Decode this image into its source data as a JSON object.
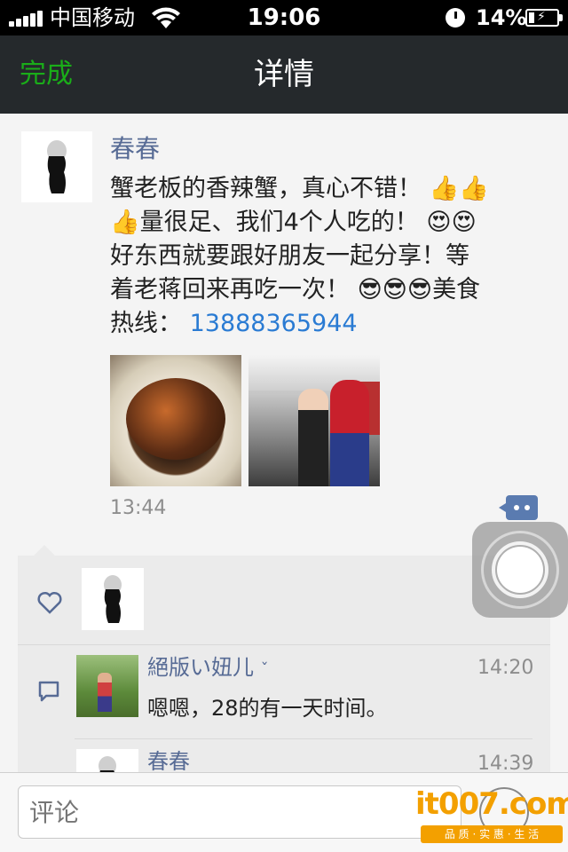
{
  "status_bar": {
    "carrier": "中国移动",
    "time": "19:06",
    "battery_percent": "14%",
    "battery_level": 0.14
  },
  "nav": {
    "done_label": "完成",
    "title": "详情"
  },
  "post": {
    "author": "春春",
    "text_lines": [
      "蟹老板的香辣蟹，真心不错！",
      "量很足、我们4个人吃的！",
      "好东西就要跟好朋友一起分享！等",
      "着老蒋回来再吃一次！",
      "美食",
      "热线："
    ],
    "phone": "13888365944",
    "time": "13:44",
    "photos": [
      "crab-dish-photo",
      "spiderman-photo"
    ],
    "emojis": {
      "thumbs": "👍",
      "heart_eyes": "😍",
      "sunglasses": "😎"
    }
  },
  "likes": {
    "icon": "heart-icon"
  },
  "comments": [
    {
      "name": "絕版い妞儿",
      "time": "14:20",
      "text": "嗯嗯，28的有一天时间。"
    },
    {
      "name": "春春",
      "time": "14:39",
      "text": ""
    }
  ],
  "input": {
    "placeholder": "评论"
  },
  "watermark": {
    "brand": "it007.com",
    "tagline": "品 质 · 实 惠 · 生 活"
  }
}
